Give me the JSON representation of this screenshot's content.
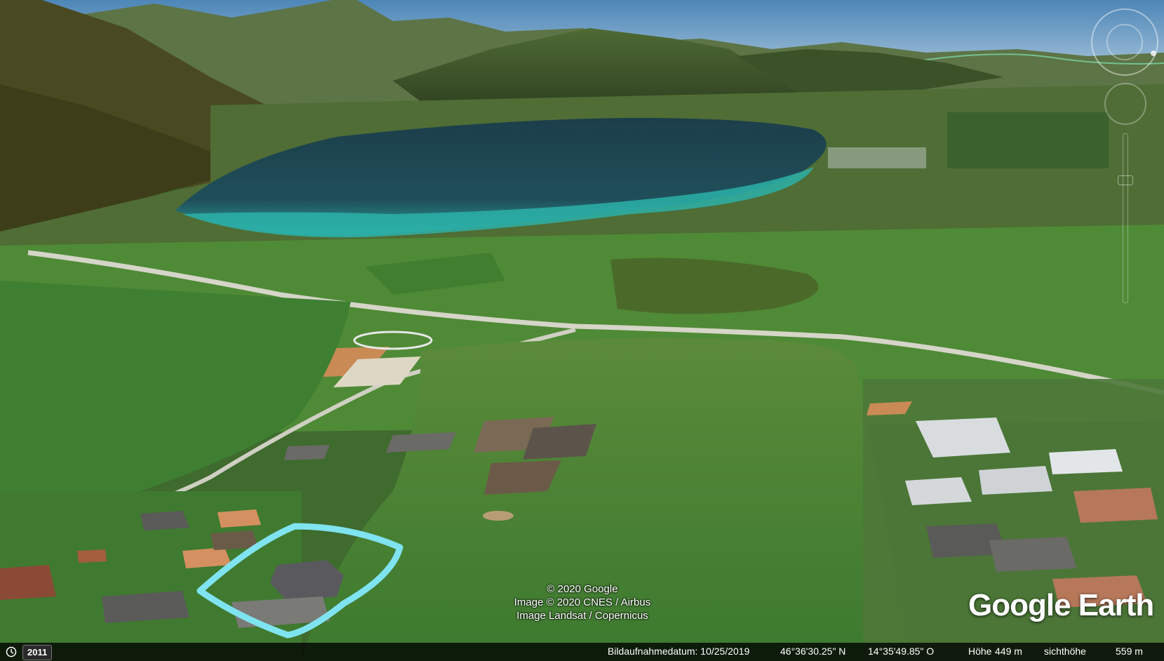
{
  "attribution": {
    "line1": "© 2020 Google",
    "line2": "Image © 2020 CNES / Airbus",
    "line3": "Image Landsat / Copernicus"
  },
  "logo": "Google Earth",
  "status": {
    "year": "2011",
    "imagery_date": "Bildaufnahmedatum: 10/25/2019",
    "latitude": "46°36'30.25\" N",
    "longitude": "14°35'49.85\" O",
    "elevation_label": "Höhe",
    "elevation_value": "449 m",
    "eye_alt_label": "sichthöhe",
    "eye_alt_value": "559 m"
  },
  "icons": {
    "history": "clock-icon",
    "navigation": "compass-icon",
    "zoom": "zoom-slider-icon"
  },
  "colors": {
    "highlight": "#7fe3f0",
    "lake": "#1f4a55",
    "shallow_water": "#2bb0a8",
    "meadow": "#3f7f32"
  }
}
